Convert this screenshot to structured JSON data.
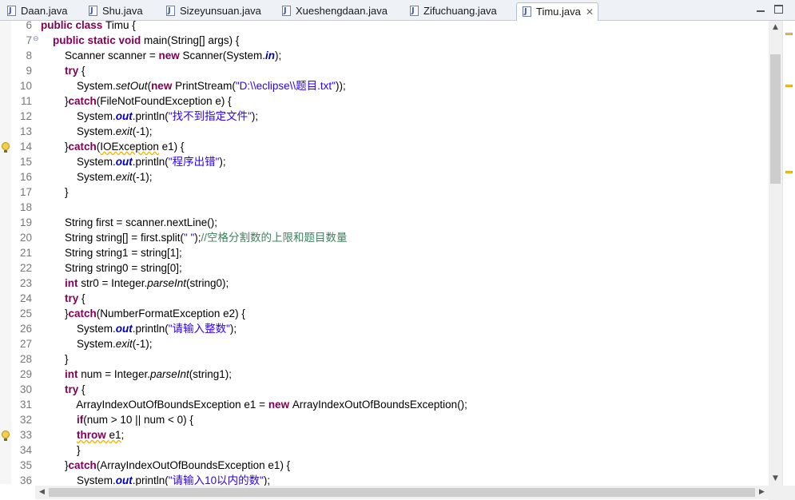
{
  "tabs": [
    {
      "name": "Daan.java"
    },
    {
      "name": "Shu.java"
    },
    {
      "name": "Sizeyunsuan.java"
    },
    {
      "name": "Xueshengdaan.java"
    },
    {
      "name": "Zifuchuang.java"
    },
    {
      "name": "Timu.java",
      "active": true
    }
  ],
  "editor": {
    "lines": [
      {
        "num": "6",
        "segs": [
          {
            "t": "public class ",
            "c": "kw"
          },
          {
            "t": "Timu {"
          }
        ]
      },
      {
        "num": "7",
        "fold": true,
        "segs": [
          {
            "t": "    "
          },
          {
            "t": "public static void ",
            "c": "kw"
          },
          {
            "t": "main(String[] "
          },
          {
            "t": "args",
            "c": "var"
          },
          {
            "t": ") {"
          }
        ]
      },
      {
        "num": "8",
        "segs": [
          {
            "t": "        Scanner "
          },
          {
            "t": "scanner",
            "c": "var"
          },
          {
            "t": " = "
          },
          {
            "t": "new ",
            "c": "kw"
          },
          {
            "t": "Scanner(System."
          },
          {
            "t": "in",
            "c": "fld"
          },
          {
            "t": ");"
          }
        ]
      },
      {
        "num": "9",
        "segs": [
          {
            "t": "        "
          },
          {
            "t": "try",
            "c": "kw"
          },
          {
            "t": " {"
          }
        ]
      },
      {
        "num": "10",
        "segs": [
          {
            "t": "            System."
          },
          {
            "t": "setOut",
            "c": "it"
          },
          {
            "t": "("
          },
          {
            "t": "new ",
            "c": "kw"
          },
          {
            "t": "PrintStream("
          },
          {
            "t": "\"D:\\\\eclipse\\\\题目.txt\"",
            "c": "str"
          },
          {
            "t": "));"
          }
        ]
      },
      {
        "num": "11",
        "segs": [
          {
            "t": "        }"
          },
          {
            "t": "catch",
            "c": "kw"
          },
          {
            "t": "(FileNotFoundException "
          },
          {
            "t": "e",
            "c": "var"
          },
          {
            "t": ") {"
          }
        ]
      },
      {
        "num": "12",
        "segs": [
          {
            "t": "            System."
          },
          {
            "t": "out",
            "c": "fld"
          },
          {
            "t": ".println("
          },
          {
            "t": "\"找不到指定文件\"",
            "c": "str"
          },
          {
            "t": ");"
          }
        ]
      },
      {
        "num": "13",
        "segs": [
          {
            "t": "            System."
          },
          {
            "t": "exit",
            "c": "it"
          },
          {
            "t": "(-1);"
          }
        ]
      },
      {
        "num": "14",
        "warn": true,
        "segs": [
          {
            "t": "        }"
          },
          {
            "t": "catch",
            "c": "kw"
          },
          {
            "t": "("
          },
          {
            "t": "IOException",
            "c": "warn"
          },
          {
            "t": " "
          },
          {
            "t": "e1",
            "c": "var"
          },
          {
            "t": ") {"
          }
        ]
      },
      {
        "num": "15",
        "segs": [
          {
            "t": "            System."
          },
          {
            "t": "out",
            "c": "fld"
          },
          {
            "t": ".println("
          },
          {
            "t": "\"程序出错\"",
            "c": "str"
          },
          {
            "t": ");"
          }
        ]
      },
      {
        "num": "16",
        "segs": [
          {
            "t": "            System."
          },
          {
            "t": "exit",
            "c": "it"
          },
          {
            "t": "(-1);"
          }
        ]
      },
      {
        "num": "17",
        "segs": [
          {
            "t": "        }"
          }
        ]
      },
      {
        "num": "18",
        "segs": [
          {
            "t": ""
          }
        ]
      },
      {
        "num": "19",
        "segs": [
          {
            "t": "        String "
          },
          {
            "t": "first",
            "c": "var"
          },
          {
            "t": " = "
          },
          {
            "t": "scanner",
            "c": "var"
          },
          {
            "t": ".nextLine();"
          }
        ]
      },
      {
        "num": "20",
        "segs": [
          {
            "t": "        String "
          },
          {
            "t": "string",
            "c": "var"
          },
          {
            "t": "[] = "
          },
          {
            "t": "first",
            "c": "var"
          },
          {
            "t": ".split("
          },
          {
            "t": "\" \"",
            "c": "str"
          },
          {
            "t": ");"
          },
          {
            "t": "//空格分割数的上限和题目数量",
            "c": "cm"
          }
        ]
      },
      {
        "num": "21",
        "segs": [
          {
            "t": "        String "
          },
          {
            "t": "string1",
            "c": "var"
          },
          {
            "t": " = "
          },
          {
            "t": "string",
            "c": "var"
          },
          {
            "t": "[1];"
          }
        ]
      },
      {
        "num": "22",
        "segs": [
          {
            "t": "        String "
          },
          {
            "t": "string0",
            "c": "var"
          },
          {
            "t": " = "
          },
          {
            "t": "string",
            "c": "var"
          },
          {
            "t": "[0];"
          }
        ]
      },
      {
        "num": "23",
        "segs": [
          {
            "t": "        "
          },
          {
            "t": "int ",
            "c": "kw"
          },
          {
            "t": "str0",
            "c": "var"
          },
          {
            "t": " = Integer."
          },
          {
            "t": "parseInt",
            "c": "it"
          },
          {
            "t": "("
          },
          {
            "t": "string0",
            "c": "var"
          },
          {
            "t": ");"
          }
        ]
      },
      {
        "num": "24",
        "segs": [
          {
            "t": "        "
          },
          {
            "t": "try",
            "c": "kw"
          },
          {
            "t": " {"
          }
        ]
      },
      {
        "num": "25",
        "segs": [
          {
            "t": "        }"
          },
          {
            "t": "catch",
            "c": "kw"
          },
          {
            "t": "(NumberFormatException "
          },
          {
            "t": "e2",
            "c": "var"
          },
          {
            "t": ") {"
          }
        ]
      },
      {
        "num": "26",
        "segs": [
          {
            "t": "            System."
          },
          {
            "t": "out",
            "c": "fld"
          },
          {
            "t": ".println("
          },
          {
            "t": "\"请输入整数\"",
            "c": "str"
          },
          {
            "t": ");"
          }
        ]
      },
      {
        "num": "27",
        "segs": [
          {
            "t": "            System."
          },
          {
            "t": "exit",
            "c": "it"
          },
          {
            "t": "(-1);"
          }
        ]
      },
      {
        "num": "28",
        "segs": [
          {
            "t": "        }"
          }
        ]
      },
      {
        "num": "29",
        "segs": [
          {
            "t": "        "
          },
          {
            "t": "int ",
            "c": "kw"
          },
          {
            "t": "num",
            "c": "var"
          },
          {
            "t": " = Integer."
          },
          {
            "t": "parseInt",
            "c": "it"
          },
          {
            "t": "("
          },
          {
            "t": "string1",
            "c": "var"
          },
          {
            "t": ");"
          }
        ]
      },
      {
        "num": "30",
        "segs": [
          {
            "t": "        "
          },
          {
            "t": "try",
            "c": "kw"
          },
          {
            "t": " {"
          }
        ]
      },
      {
        "num": "31",
        "segs": [
          {
            "t": "            ArrayIndexOutOfBoundsException "
          },
          {
            "t": "e1",
            "c": "var"
          },
          {
            "t": " = "
          },
          {
            "t": "new ",
            "c": "kw"
          },
          {
            "t": "ArrayIndexOutOfBoundsException();"
          }
        ]
      },
      {
        "num": "32",
        "segs": [
          {
            "t": "            "
          },
          {
            "t": "if",
            "c": "kw"
          },
          {
            "t": "("
          },
          {
            "t": "num",
            "c": "var"
          },
          {
            "t": " > 10 || "
          },
          {
            "t": "num",
            "c": "var"
          },
          {
            "t": " < 0) {"
          }
        ]
      },
      {
        "num": "33",
        "warn": true,
        "segs": [
          {
            "t": "            "
          },
          {
            "t": "throw ",
            "c": "kw warn"
          },
          {
            "t": "e1",
            "c": "var warn"
          },
          {
            "t": ";"
          }
        ]
      },
      {
        "num": "34",
        "segs": [
          {
            "t": "            }"
          }
        ]
      },
      {
        "num": "35",
        "segs": [
          {
            "t": "        }"
          },
          {
            "t": "catch",
            "c": "kw"
          },
          {
            "t": "(ArrayIndexOutOfBoundsException "
          },
          {
            "t": "e1",
            "c": "var"
          },
          {
            "t": ") {"
          }
        ]
      },
      {
        "num": "36",
        "segs": [
          {
            "t": "            System."
          },
          {
            "t": "out",
            "c": "fld"
          },
          {
            "t": ".println("
          },
          {
            "t": "\"请输入10以内的数\"",
            "c": "str"
          },
          {
            "t": ");"
          }
        ]
      }
    ]
  },
  "overview_ruler": {
    "marks": 3
  }
}
